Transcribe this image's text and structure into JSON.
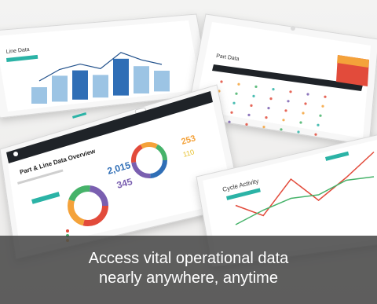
{
  "caption": {
    "line1": "Access vital operational data",
    "line2": "nearly anywhere, anytime"
  },
  "tablets": {
    "top_left": {
      "title": "Line Data"
    },
    "top_right": {
      "title": "Part Data"
    },
    "center": {
      "title": "Part & Line Data Overview",
      "metric_a": "2,015",
      "metric_b": "345",
      "metric_c": "253",
      "metric_d": "110"
    },
    "bottom_right": {
      "title": "Cycle Activity"
    }
  },
  "colors": {
    "teal": "#2bb3a6",
    "blue": "#2f6eb6",
    "light_blue": "#9cc4e4",
    "purple": "#7a5fb0",
    "orange": "#f4a23a",
    "red": "#e24b3b",
    "green": "#46b36a",
    "dark_header": "#1f2328",
    "caption_bg": "#464646"
  },
  "charts": {
    "line_data_bars": [
      0.35,
      0.55,
      0.62,
      0.48,
      0.78,
      0.58,
      0.44
    ],
    "cycle_activity_series": [
      {
        "color": "#e24b3b",
        "values": [
          0.55,
          0.25,
          0.8,
          0.3,
          0.6,
          0.95
        ]
      },
      {
        "color": "#46b36a",
        "values": [
          0.2,
          0.35,
          0.45,
          0.4,
          0.55,
          0.5
        ]
      }
    ]
  }
}
